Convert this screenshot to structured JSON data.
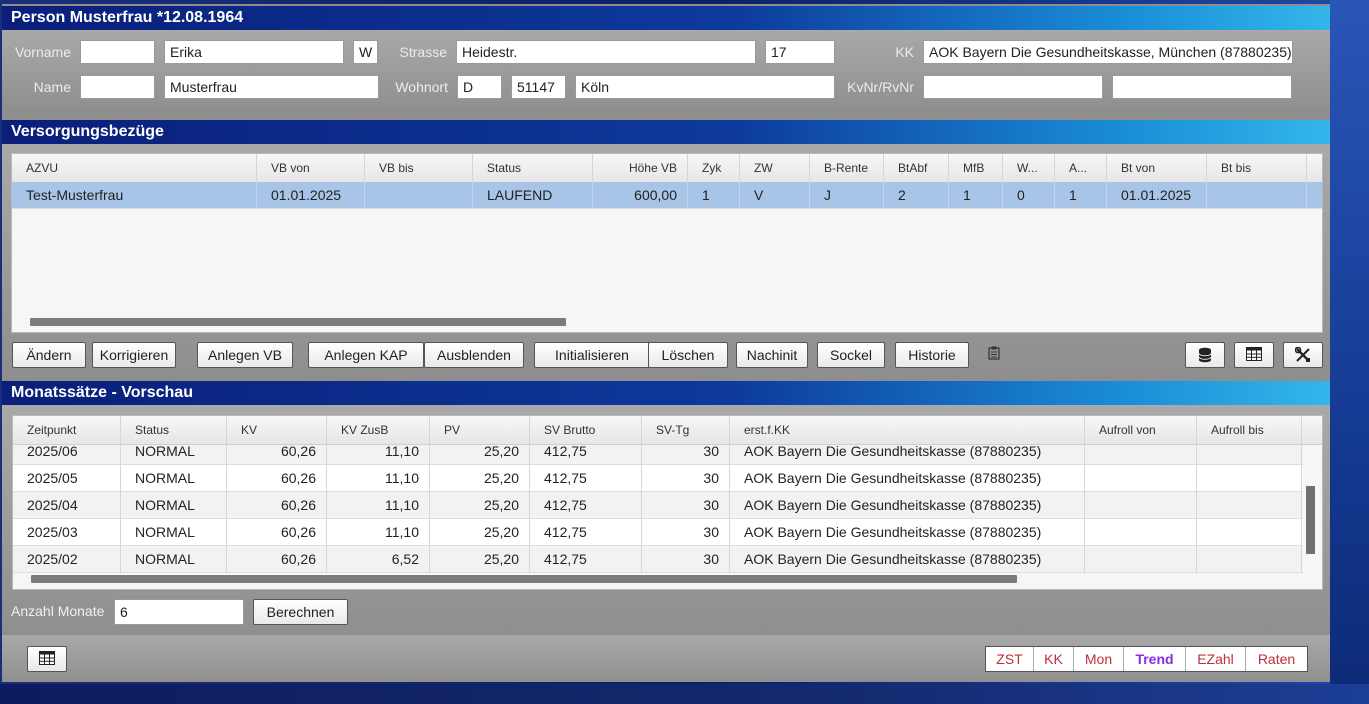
{
  "person": {
    "header": "Person Musterfrau *12.08.1964",
    "labels": {
      "vorname": "Vorname",
      "name": "Name",
      "strasse": "Strasse",
      "wohnort": "Wohnort",
      "kk": "KK",
      "kvnr": "KvNr/RvNr"
    },
    "vorname_prefix": "",
    "vorname": "Erika",
    "geschlecht": "W",
    "name_prefix": "",
    "name": "Musterfrau",
    "strasse": "Heidestr.",
    "hausnr": "17",
    "land": "D",
    "plz": "51147",
    "ort": "Köln",
    "kk": "AOK Bayern Die Gesundheitskasse, München (87880235)",
    "kvnr": "",
    "rvnr": ""
  },
  "versorgung": {
    "header": "Versorgungsbezüge",
    "columns": [
      "AZVU",
      "VB von",
      "VB bis",
      "Status",
      "Höhe VB",
      "Zyk",
      "ZW",
      "B-Rente",
      "BtAbf",
      "MfB",
      "W...",
      "A...",
      "Bt von",
      "Bt bis"
    ],
    "rows": [
      [
        "Test-Musterfrau",
        "01.01.2025",
        "",
        "LAUFEND",
        "600,00",
        "1",
        "V",
        "J",
        "2",
        "1",
        "0",
        "1",
        "01.01.2025",
        ""
      ]
    ],
    "buttons": [
      "Ändern",
      "Korrigieren",
      "Anlegen VB",
      "Anlegen KAP",
      "Ausblenden",
      "Initialisieren",
      "Löschen",
      "Nachinit",
      "Sockel",
      "Historie"
    ]
  },
  "monat": {
    "header": "Monatssätze - Vorschau",
    "columns": [
      "Zeitpunkt",
      "Status",
      "KV",
      "KV ZusB",
      "PV",
      "SV Brutto",
      "SV-Tg",
      "erst.f.KK",
      "Aufroll von",
      "Aufroll bis"
    ],
    "rows": [
      [
        "2025/06",
        "NORMAL",
        "60,26",
        "11,10",
        "25,20",
        "412,75",
        "30",
        "AOK Bayern Die Gesundheitskasse (87880235)",
        "",
        ""
      ],
      [
        "2025/05",
        "NORMAL",
        "60,26",
        "11,10",
        "25,20",
        "412,75",
        "30",
        "AOK Bayern Die Gesundheitskasse (87880235)",
        "",
        ""
      ],
      [
        "2025/04",
        "NORMAL",
        "60,26",
        "11,10",
        "25,20",
        "412,75",
        "30",
        "AOK Bayern Die Gesundheitskasse (87880235)",
        "",
        ""
      ],
      [
        "2025/03",
        "NORMAL",
        "60,26",
        "11,10",
        "25,20",
        "412,75",
        "30",
        "AOK Bayern Die Gesundheitskasse (87880235)",
        "",
        ""
      ],
      [
        "2025/02",
        "NORMAL",
        "60,26",
        "6,52",
        "25,20",
        "412,75",
        "30",
        "AOK Bayern Die Gesundheitskasse (87880235)",
        "",
        ""
      ]
    ],
    "anzahl_label": "Anzahl Monate",
    "anzahl_value": "6",
    "berechnen": "Berechnen"
  },
  "tabs": [
    {
      "label": "ZST",
      "active": false
    },
    {
      "label": "KK",
      "active": false
    },
    {
      "label": "Mon",
      "active": false
    },
    {
      "label": "Trend",
      "active": true
    },
    {
      "label": "EZahl",
      "active": false
    },
    {
      "label": "Raten",
      "active": false
    }
  ],
  "colors": {
    "tab_text": "#c0303a",
    "tab_active": "#8a2be2",
    "header_start": "#0a1e7a",
    "header_end": "#33b6ea"
  }
}
